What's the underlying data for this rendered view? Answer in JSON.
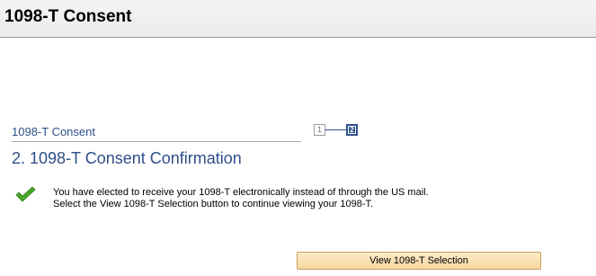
{
  "header": {
    "title": "1098-T Consent"
  },
  "train": {
    "link_label": "1098-T Consent",
    "steps": [
      "1",
      "2"
    ],
    "current_step": 2
  },
  "main": {
    "heading": "2. 1098-T Consent Confirmation",
    "icon": "checkmark-icon",
    "message_line1": "You have elected to receive your 1098-T electronically instead of through the US mail.",
    "message_line2": "Select the View 1098-T Selection button to continue viewing your 1098-T."
  },
  "button": {
    "label": "View 1098-T Selection"
  },
  "colors": {
    "link": "#2e4f89",
    "check": "#4aa52c",
    "button_bg": "#fbe3b6"
  }
}
